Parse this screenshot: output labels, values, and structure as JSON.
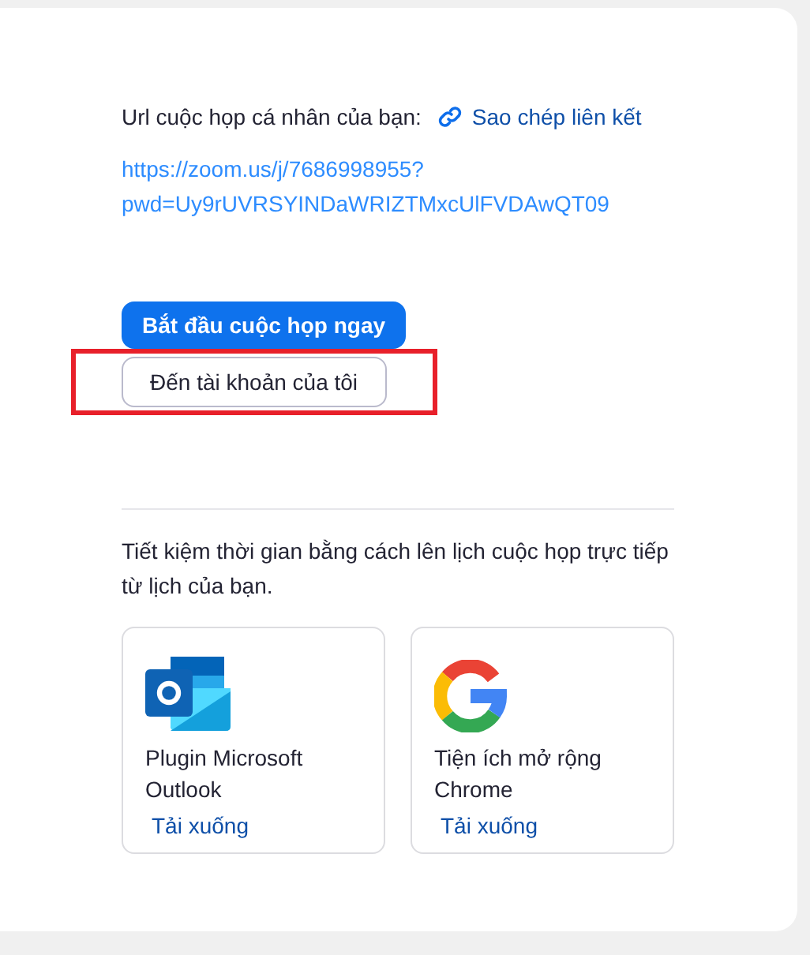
{
  "meeting_url": {
    "label": "Url cuộc họp cá nhân của bạn:",
    "copy_link": "Sao chép liên kết",
    "url": "https://zoom.us/j/7686998955?pwd=Uy9rUVRSYINDaWRIZTMxcUlFVDAwQT09"
  },
  "buttons": [
    {
      "label": "Bắt đầu cuộc họp ngay",
      "kind": "primary",
      "highlighted": false
    },
    {
      "label": "Đến tài khoản của tôi",
      "kind": "secondary",
      "highlighted": true
    }
  ],
  "calendar": {
    "text": "Tiết kiệm thời gian bằng cách lên lịch cuộc họp trực tiếp từ lịch của bạn.",
    "integrations": [
      {
        "kind": "outlook",
        "name": "Plugin Microsoft Outlook",
        "action": "Tải xuống"
      },
      {
        "kind": "chrome",
        "name": "Tiện ích mở rộng Chrome",
        "action": "Tải xuống"
      }
    ]
  }
}
